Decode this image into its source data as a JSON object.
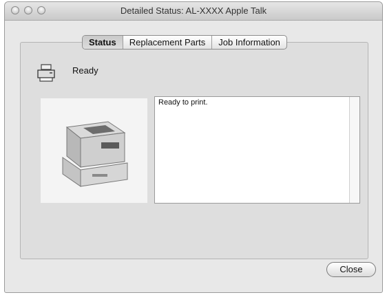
{
  "window": {
    "title": "Detailed Status: AL-XXXX  Apple Talk"
  },
  "tabs": [
    {
      "label": "Status",
      "selected": true
    },
    {
      "label": "Replacement Parts",
      "selected": false
    },
    {
      "label": "Job Information",
      "selected": false
    }
  ],
  "status": {
    "icon": "printer-status-icon",
    "text": "Ready"
  },
  "message": {
    "text": "Ready to print."
  },
  "buttons": {
    "close_label": "Close"
  }
}
